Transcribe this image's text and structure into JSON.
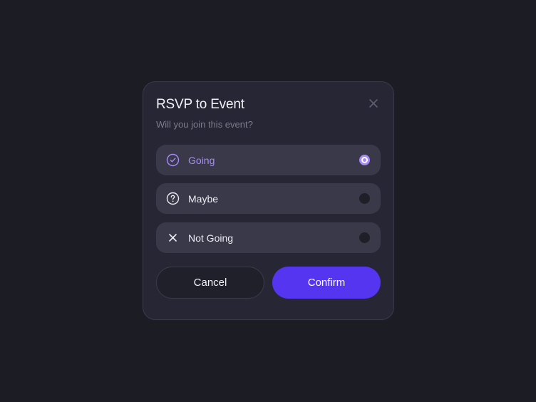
{
  "dialog": {
    "title": "RSVP to Event",
    "subtitle": "Will you join this event?",
    "close_icon": "close-icon"
  },
  "options": [
    {
      "label": "Going",
      "icon": "check-circle-icon",
      "selected": true
    },
    {
      "label": "Maybe",
      "icon": "question-circle-icon",
      "selected": false
    },
    {
      "label": "Not Going",
      "icon": "x-icon",
      "selected": false
    }
  ],
  "buttons": {
    "cancel_label": "Cancel",
    "confirm_label": "Confirm"
  },
  "colors": {
    "background": "#1c1c25",
    "dialog": "#262634",
    "option": "#393949",
    "accent": "#a78bfa",
    "primary": "#5535ef"
  }
}
